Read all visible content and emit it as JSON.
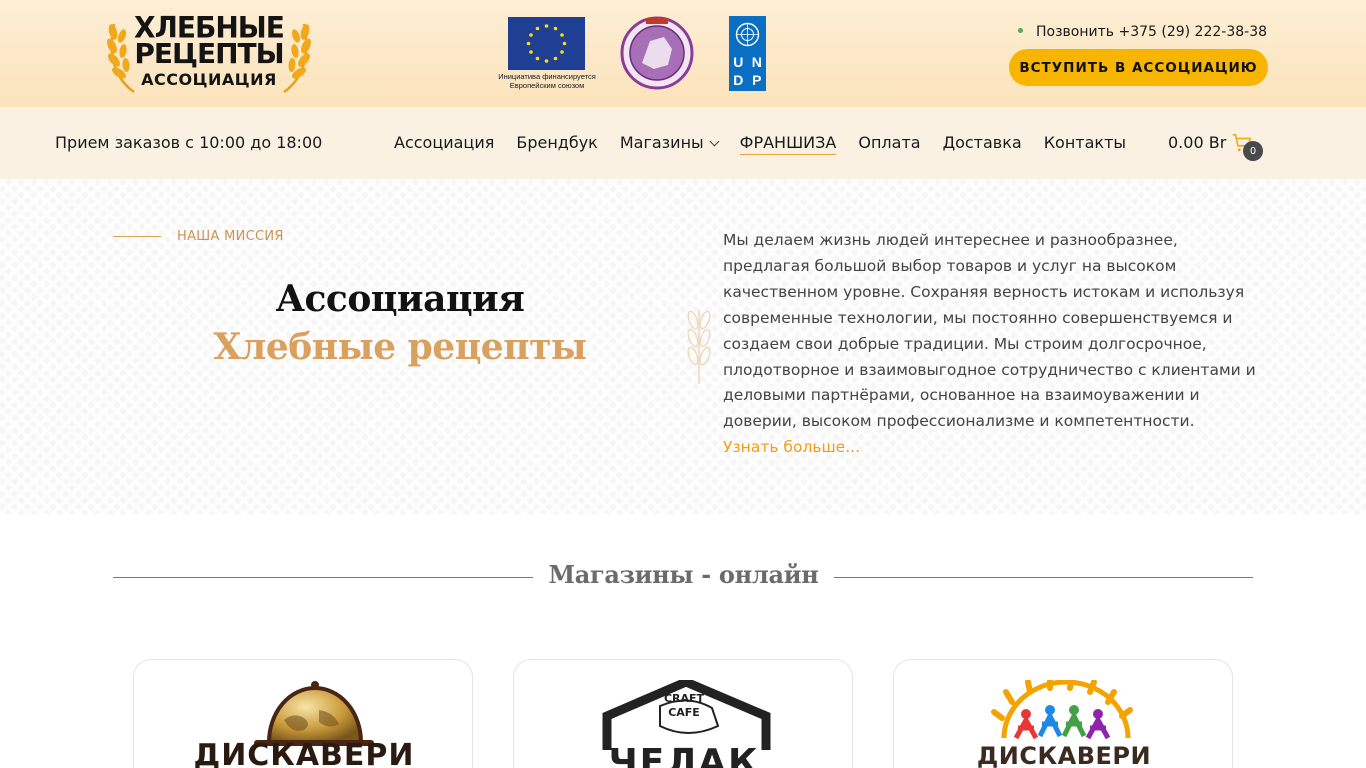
{
  "header": {
    "logo": {
      "line1": "ХЛЕБНЫЕ",
      "line2": "РЕЦЕПТЫ",
      "line3": "АССОЦИАЦИЯ"
    },
    "partners": {
      "eu_caption": "Инициатива финансируется Европейским союзом",
      "undp_letters": [
        "U",
        "N",
        "D",
        "P"
      ]
    },
    "call_text": "Позвонить +375 (29) 222-38-38",
    "join_button": "ВСТУПИТЬ В АССОЦИАЦИЮ"
  },
  "nav": {
    "hours": "Прием заказов с 10:00 до 18:00",
    "items": [
      {
        "label": "Ассоциация"
      },
      {
        "label": "Брендбук"
      },
      {
        "label": "Магазины"
      },
      {
        "label": "ФРАНШИЗА"
      },
      {
        "label": "Оплата"
      },
      {
        "label": "Доставка"
      },
      {
        "label": "Контакты"
      }
    ],
    "cart_total": "0.00 Br",
    "cart_count": "0"
  },
  "mission": {
    "eyebrow": "НАША МИССИЯ",
    "title_line1": "Ассоциация",
    "title_line2": "Хлебные рецепты",
    "text": "Мы делаем жизнь людей интереснее и разнообразнее, предлагая большой выбор товаров и услуг на высоком качественном уровне. Сохраняя верность истокам и используя современные технологии, мы постоянно совершенствуемся и создаем свои добрые традиции. Мы строим долгосрочное, плодотворное и взаимовыгодное сотрудничество с клиентами и деловыми партнёрами, основанное на взаимоуважении и доверии, высоком профессионализме и компетентности.",
    "learn_more": "Узнать больше..."
  },
  "shops": {
    "heading": "Магазины - онлайн",
    "cards": [
      {
        "name": "ДИСКАВЕРИ"
      },
      {
        "badge_line1": "CRAFT",
        "badge_line2": "CAFE",
        "name": "ЧЕЛАК"
      },
      {
        "name": "ДИСКАВЕРИ"
      }
    ]
  },
  "colors": {
    "accent": "#f7b500",
    "gold_text": "#d9a05e",
    "link": "#f29c1a",
    "header_bg": "#fdeed5",
    "nav_bg": "#faf1e3"
  }
}
